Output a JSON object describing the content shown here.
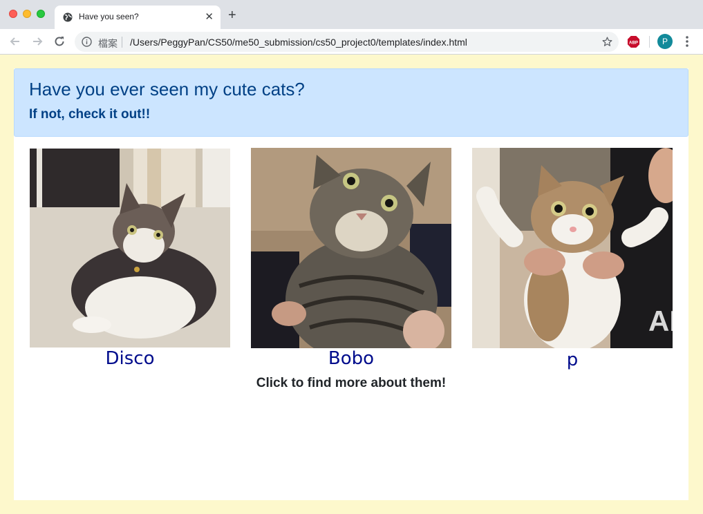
{
  "browser": {
    "tab_title": "Have you seen?",
    "address_label": "檔案",
    "url": "/Users/PeggyPan/CS50/me50_submission/cs50_project0/templates/index.html",
    "profile_initial": "P"
  },
  "page": {
    "heading": "Have you ever seen my cute cats?",
    "subheading": "If not, check it out!!",
    "cats": [
      {
        "name": "Disco"
      },
      {
        "name": "Bobo"
      },
      {
        "name": "p"
      }
    ],
    "footer": "Click to find more about them!"
  },
  "colors": {
    "page_background": "#fdf8cc",
    "alert_background": "#cce5ff",
    "alert_text": "#004085",
    "cat_name": "#000c8c"
  }
}
